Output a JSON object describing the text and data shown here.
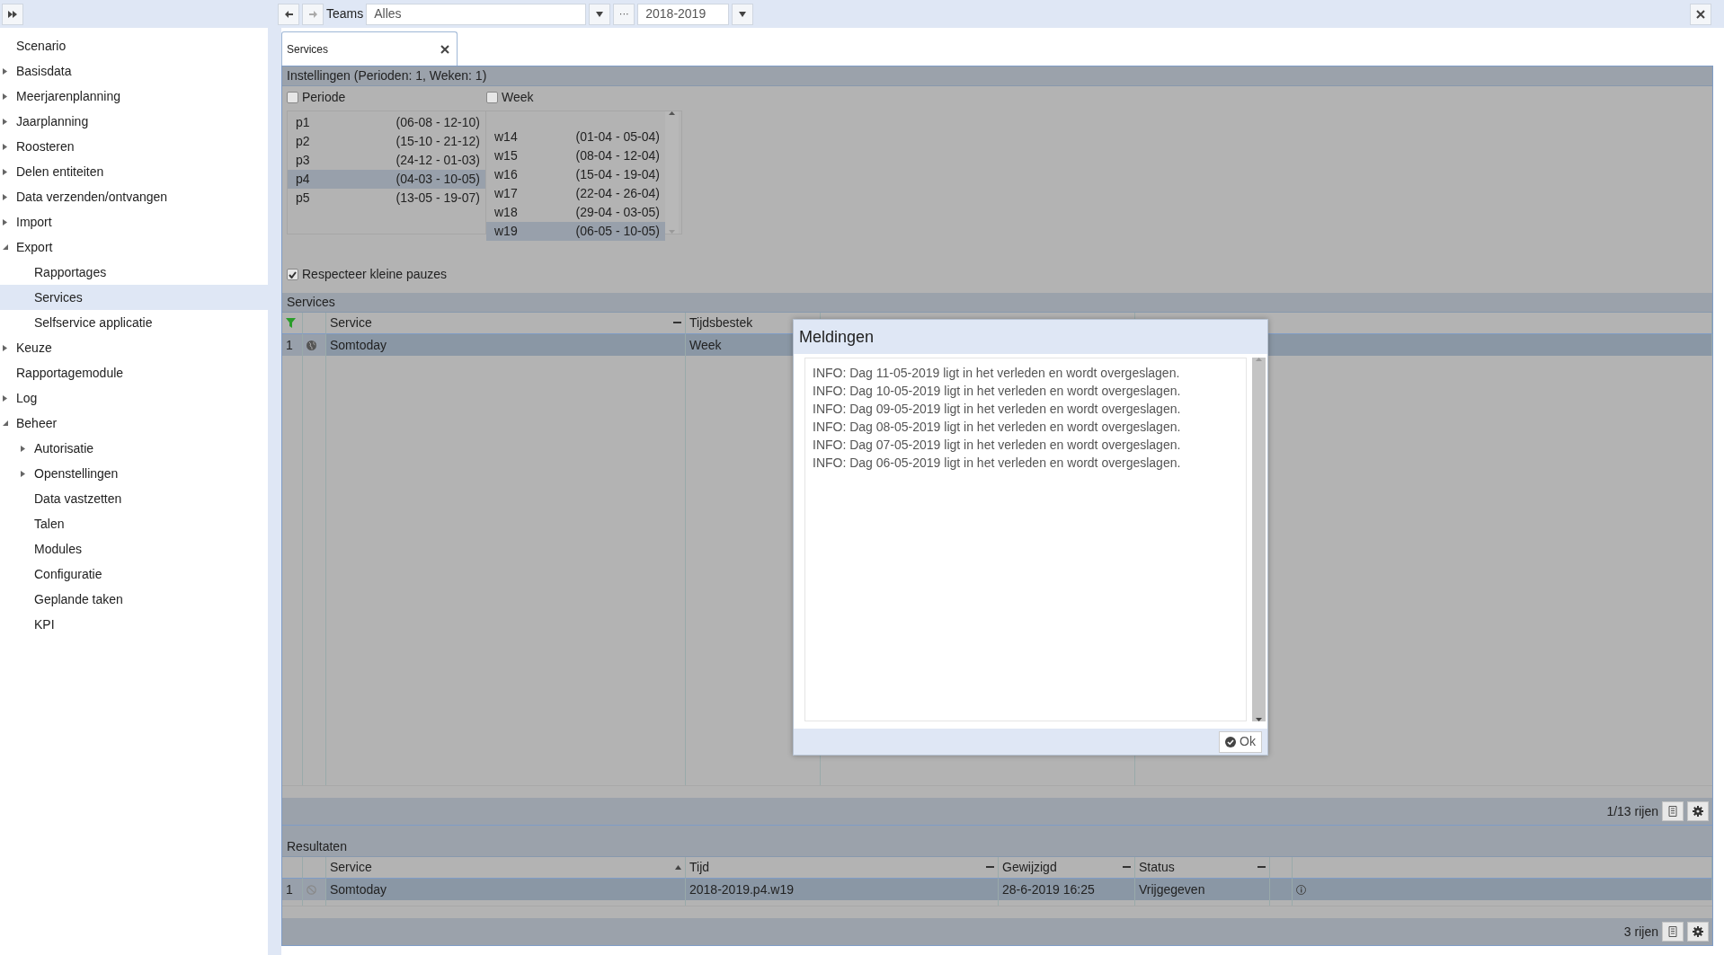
{
  "toolbar": {
    "teams_label": "Teams",
    "teams_value": "Alles",
    "more_button": "···",
    "year_value": "2018-2019"
  },
  "sidebar": {
    "items": [
      {
        "label": "Scenario",
        "selected": false
      },
      {
        "label": "Basisdata",
        "selected": false,
        "expanded": false
      },
      {
        "label": "Meerjarenplanning",
        "selected": false,
        "expanded": false
      },
      {
        "label": "Jaarplanning",
        "selected": false,
        "expanded": false
      },
      {
        "label": "Roosteren",
        "selected": false,
        "expanded": false
      },
      {
        "label": "Delen entiteiten",
        "selected": false,
        "expanded": false
      },
      {
        "label": "Data verzenden/ontvangen",
        "selected": false,
        "expanded": false
      },
      {
        "label": "Import",
        "selected": false,
        "expanded": false
      },
      {
        "label": "Export",
        "selected": false,
        "expanded": true,
        "children": [
          {
            "label": "Rapportages",
            "selected": false
          },
          {
            "label": "Services",
            "selected": true
          },
          {
            "label": "Selfservice applicatie",
            "selected": false
          }
        ]
      },
      {
        "label": "Keuze",
        "selected": false,
        "expanded": false
      },
      {
        "label": "Rapportagemodule",
        "selected": false
      },
      {
        "label": "Log",
        "selected": false,
        "expanded": false
      },
      {
        "label": "Beheer",
        "selected": false,
        "expanded": true,
        "children": [
          {
            "label": "Autorisatie",
            "selected": false,
            "expanded": false
          },
          {
            "label": "Openstellingen",
            "selected": false,
            "expanded": false
          },
          {
            "label": "Data vastzetten",
            "selected": false
          },
          {
            "label": "Talen",
            "selected": false
          },
          {
            "label": "Modules",
            "selected": false
          },
          {
            "label": "Configuratie",
            "selected": false
          },
          {
            "label": "Geplande taken",
            "selected": false
          },
          {
            "label": "KPI",
            "selected": false
          }
        ]
      }
    ]
  },
  "tabs": [
    {
      "label": "Services",
      "selected": true
    }
  ],
  "settings": {
    "title": "Instellingen (Perioden: 1, Weken: 1)",
    "periode": {
      "label": "Periode",
      "checked": false,
      "items": [
        {
          "name": "p1",
          "range": "(06-08 - 12-10)",
          "selected": false
        },
        {
          "name": "p2",
          "range": "(15-10 - 21-12)",
          "selected": false
        },
        {
          "name": "p3",
          "range": "(24-12 - 01-03)",
          "selected": false
        },
        {
          "name": "p4",
          "range": "(04-03 - 10-05)",
          "selected": true
        },
        {
          "name": "p5",
          "range": "(13-05 - 19-07)",
          "selected": false
        }
      ]
    },
    "week": {
      "label": "Week",
      "checked": false,
      "items": [
        {
          "name": "w14",
          "range": "(01-04 - 05-04)",
          "selected": false
        },
        {
          "name": "w15",
          "range": "(08-04 - 12-04)",
          "selected": false
        },
        {
          "name": "w16",
          "range": "(15-04 - 19-04)",
          "selected": false
        },
        {
          "name": "w17",
          "range": "(22-04 - 26-04)",
          "selected": false
        },
        {
          "name": "w18",
          "range": "(29-04 - 03-05)",
          "selected": false
        },
        {
          "name": "w19",
          "range": "(06-05 - 10-05)",
          "selected": true
        }
      ]
    },
    "respect": {
      "label": "Respecteer kleine pauzes",
      "checked": true
    }
  },
  "services": {
    "title": "Services",
    "columns": [
      {
        "label": "Service",
        "sorted": false
      },
      {
        "label": "Tijdsbestek"
      }
    ],
    "rows": [
      {
        "number": "1",
        "cells": [
          "Somtoday",
          "Week"
        ],
        "selected": true
      }
    ],
    "footer": "1/13 rijen"
  },
  "results": {
    "title": "Resultaten",
    "columns": [
      {
        "label": "Service",
        "sorted": true
      },
      {
        "label": "Tijd",
        "sorted": false
      },
      {
        "label": "Gewijzigd",
        "sorted": false
      },
      {
        "label": "Status",
        "sorted": false
      }
    ],
    "rows": [
      {
        "number": "1",
        "cells": [
          "Somtoday",
          "2018-2019.p4.w19",
          "28-6-2019 16:25",
          "Vrijgegeven"
        ],
        "selected": true
      }
    ],
    "footer": "3 rijen"
  },
  "dialog": {
    "title": "Meldingen",
    "messages": [
      "INFO: Dag 11-05-2019 ligt in het verleden en wordt overgeslagen.",
      "INFO: Dag 10-05-2019 ligt in het verleden en wordt overgeslagen.",
      "INFO: Dag 09-05-2019 ligt in het verleden en wordt overgeslagen.",
      "INFO: Dag 08-05-2019 ligt in het verleden en wordt overgeslagen.",
      "INFO: Dag 07-05-2019 ligt in het verleden en wordt overgeslagen.",
      "INFO: Dag 06-05-2019 ligt in het verleden en wordt overgeslagen."
    ],
    "ok_button": "Ok"
  }
}
